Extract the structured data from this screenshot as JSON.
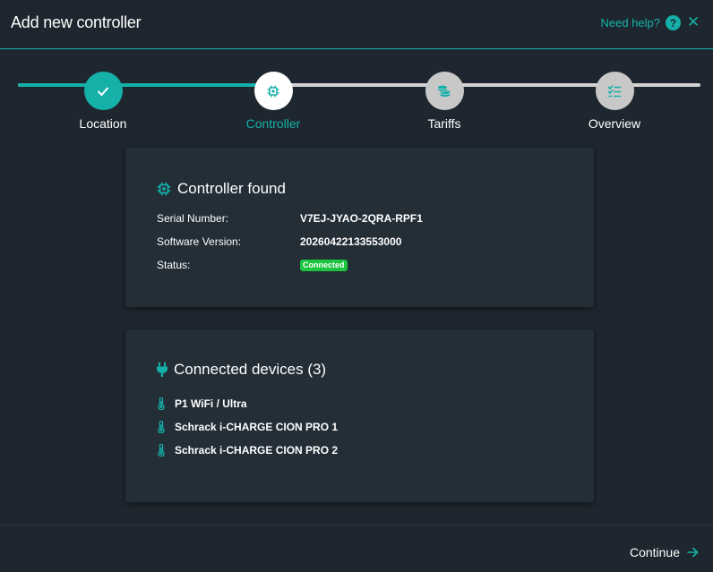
{
  "header": {
    "title": "Add new controller",
    "help_label": "Need help?",
    "help_icon_glyph": "?",
    "close_glyph": "✕"
  },
  "stepper": {
    "steps": [
      {
        "label": "Location",
        "state": "done",
        "icon": "check-icon"
      },
      {
        "label": "Controller",
        "state": "active",
        "icon": "chip-icon"
      },
      {
        "label": "Tariffs",
        "state": "todo",
        "icon": "coins-icon"
      },
      {
        "label": "Overview",
        "state": "todo",
        "icon": "checklist-icon"
      }
    ],
    "progress_fraction": 0.36
  },
  "controller_card": {
    "title": "Controller found",
    "serial_label": "Serial Number:",
    "serial_value": "V7EJ-JYAO-2QRA-RPF1",
    "software_label": "Software Version:",
    "software_value": "20260422133553000",
    "status_label": "Status:",
    "status_value": "Connected"
  },
  "devices_card": {
    "title": "Connected devices (3)",
    "devices": [
      {
        "name": "P1 WiFi / Ultra"
      },
      {
        "name": "Schrack i-CHARGE CION PRO 1"
      },
      {
        "name": "Schrack i-CHARGE CION PRO 2"
      }
    ]
  },
  "footer": {
    "continue_label": "Continue"
  },
  "colors": {
    "accent": "#15b0a8",
    "background": "#1e272f",
    "card": "#232e37",
    "status_connected": "#1cc53e",
    "step_todo": "#c8c8c8"
  }
}
